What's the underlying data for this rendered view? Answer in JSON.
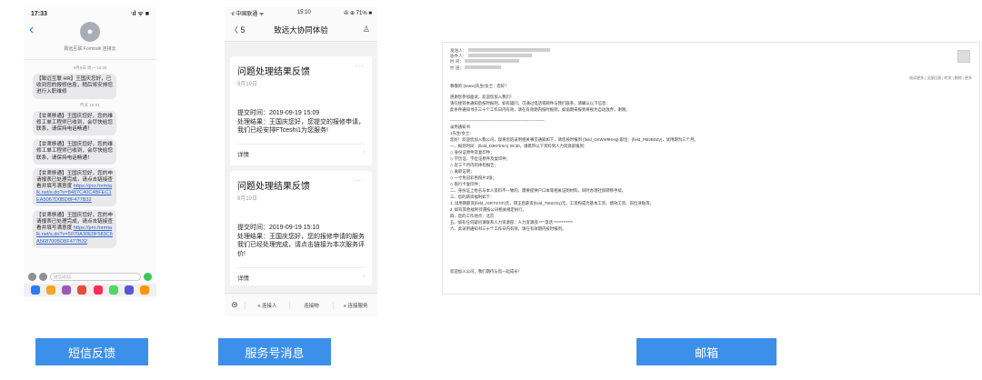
{
  "sms": {
    "status_time": "17:33",
    "status_right": "ᐧıl ᯤ ■",
    "sender": "致远互联 Formtalk 连接云",
    "time_1": "9月9日 周一 16:30",
    "time_2": "昨天 16:01",
    "messages": [
      {
        "text": "【致远互联 HR】王国庆您好，已收到您的报修信息，稍后将安排您进行入职维修"
      },
      {
        "text": "【甘肃移通】王国庆您好，您的维修工单工程师已收到，会尽快给您联系，请保持电话畅通！"
      },
      {
        "text": "【甘肃移通】王国庆您好，您的维修工单工程师已收到，会尽快给您联系，请保持电话畅通！"
      },
      {
        "text": "【甘肃移通】王国庆您好，您的申请报表已处理完成，请点击链接查看并填写满意度 ",
        "link": "https://pro.formtalk.net/s.do?v=8487C40C4BFEC1EA5067D0BD8F477B32"
      },
      {
        "text": "【甘肃移通】王国庆您好，您的申请报表已处理完成，请点击链接查看并填写满意度 ",
        "link": "https://pro.formtalk.net/s.do?v=5070A30E0F583C6A568700BD8F477B32"
      }
    ],
    "input_placeholder": "短信/彩信",
    "tray_colors": [
      "#2a7cf6",
      "#f5a623",
      "#9b59b6",
      "#e74c3c",
      "#ff2d55",
      "#4cd964",
      "#5856d6",
      "#ff9500"
    ]
  },
  "service": {
    "status_left": "ᐧıl 中国联通 ᯤ",
    "status_time": "15:10",
    "status_right": "✇ ⊕ 71% ■",
    "back_label": "〈 5",
    "title": "致远大协同体验",
    "cards": [
      {
        "title": "问题处理结果反馈",
        "date": "9月19日",
        "submit": "提交时间：2019-09-19 15:09",
        "result": "处理结果：王国庆您好，您提交的报修申请，我们已经安排FTceshi1为您服务!",
        "detail": "详情"
      },
      {
        "title": "问题处理结果反馈",
        "date": "9月19日",
        "submit": "提交时间：2019-09-19 15:10",
        "result": "处理结果：王国庆您好，您的报修申请的服务我们已经处理完成，请点击链接为本次服务评价!",
        "detail": "详情"
      }
    ],
    "menus": [
      "≡ 连接人",
      "连接物",
      "≡ 连接服务"
    ]
  },
  "mail": {
    "from_line": "发送人：",
    "to_line": "收件人：",
    "time_line": "时 间：",
    "cc_line": "抄 送：",
    "tools": "阅读更多 | 全部回复 | 转发 | 删除 | 更多",
    "greeting": "尊敬的 {name}先生/女士：您好！",
    "lines": [
      "感谢您参加面试，欢迎您加入我们！",
      "请在接到本通知后按时报到，如有疑问，可通过电话或邮件与我们联系，请确认以下信息：",
      "此条件通知书于三十个工作日内有效，请在有效期内按时报到，如逾期未报到将视为自动放弃，谢谢。",
      "-----------------------------------------------------------------------",
      "录用通知书",
      "1先生/女士：",
      "您好！欢迎您加入我公司，现将您的录用相关事宜通知如下，请您按时报到 {field_GKWW9HHg} 职位：{field_PM2BDZy}，试用期为三个月。",
      "一、报到时间：{field_D3KFbSm} 09:30，请携带以下资料到人力资源部报到：",
      "◇ 身份证原件及复印件；",
      "◇ 学历证、学位证原件及复印件；",
      "◇ 近三个月内的体检报告；",
      "◇ 离职证明；",
      "◇ 一寸免冠彩色照片3张；",
      "◇ 银行卡复印件；",
      "二、身份证上姓名与本人资料不一致的，需要提供户口本等相关证明材料，同时办理社保转移手续。",
      "三、您的薪资福利如下：",
      "1. 试用期薪资{field_zSRTG7rh}元，转正后薪资{field_7WstzGy}元。工资构成为基本工资、绩效工资、岗位津贴等；",
      "2. 如有其他福利待遇按公司相关规定执行。",
      "四、您的工作地点：北京",
      "五、如有任何疑问请联系人力资源部：人力资源部 *** 电话 ************",
      "六、此录用通知书三十个工作日内有效，请在有效期内按时报到。"
    ],
    "closing": "欢迎加入公司，我们期待与您一起成长！"
  },
  "labels": {
    "sms": "短信反馈",
    "service": "服务号消息",
    "mail": "邮箱"
  }
}
